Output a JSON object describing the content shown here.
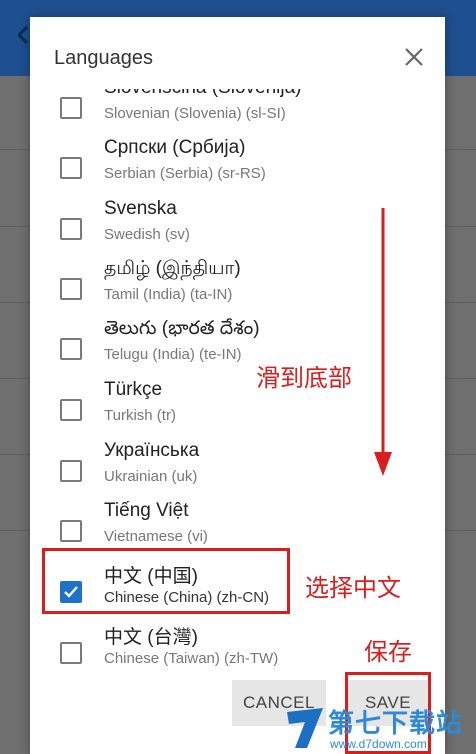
{
  "dialog": {
    "title": "Languages",
    "cancel_label": "CANCEL",
    "save_label": "SAVE"
  },
  "languages": [
    {
      "native": "Slovenščina (Slovenija)",
      "english": "Slovenian (Slovenia) (sl-SI)",
      "checked": false
    },
    {
      "native": "Српски (Србија)",
      "english": "Serbian (Serbia) (sr-RS)",
      "checked": false
    },
    {
      "native": "Svenska",
      "english": "Swedish (sv)",
      "checked": false
    },
    {
      "native": "தமிழ் (இந்தியா)",
      "english": "Tamil (India) (ta-IN)",
      "checked": false
    },
    {
      "native": "తెలుగు (భారత దేశం)",
      "english": "Telugu (India) (te-IN)",
      "checked": false
    },
    {
      "native": "Türkçe",
      "english": "Turkish (tr)",
      "checked": false
    },
    {
      "native": "Українська",
      "english": "Ukrainian (uk)",
      "checked": false
    },
    {
      "native": "Tiếng Việt",
      "english": "Vietnamese (vi)",
      "checked": false
    },
    {
      "native": "中文 (中国)",
      "english": "Chinese (China) (zh-CN)",
      "checked": true
    },
    {
      "native": "中文 (台灣)",
      "english": "Chinese (Taiwan) (zh-TW)",
      "checked": false
    }
  ],
  "annotations": {
    "scroll_hint": "滑到底部",
    "select_hint": "选择中文",
    "save_hint": "保存"
  },
  "watermark": {
    "title": "第七下载站",
    "url": "www.d7down.com"
  },
  "colors": {
    "accent": "#1e73c8",
    "annotation": "#d91e1e",
    "topbar": "#1e4f8f"
  }
}
